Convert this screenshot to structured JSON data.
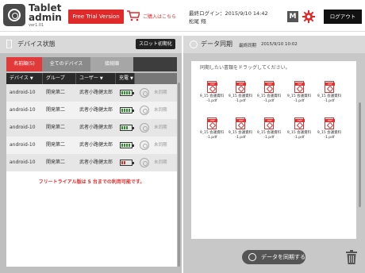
{
  "header": {
    "brand_title": "Tablet",
    "brand_subtitle": "admin",
    "version": "ver1.01",
    "trial_button": "Free Trial Version",
    "cart_label": "ご購入はこちら",
    "last_login": "最終ログイン：2015/9/10 14:42",
    "user_name": "松尾 翔",
    "m_button": "M",
    "logout_button": "ログアウト",
    "accent_color": "#e02a2a"
  },
  "left_panel": {
    "title": "デバイス状態",
    "reset_button": "スロット初期化",
    "tabs": [
      {
        "label": "名前順(5)"
      },
      {
        "label": "全てのデバイス"
      },
      {
        "label": "接続順"
      },
      {
        "label": ""
      }
    ],
    "columns": [
      {
        "label": "デバイス",
        "sort": "▼"
      },
      {
        "label": "グループ",
        "sort": ""
      },
      {
        "label": "ユーザー",
        "sort": "▼"
      },
      {
        "label": "充電",
        "sort": "▼"
      }
    ],
    "rows": [
      {
        "device": "android-10",
        "group": "開発第二",
        "user": "武者小路健太郎",
        "battery_level": 4,
        "battery_color": "#2e8b2e",
        "sync": "未同期"
      },
      {
        "device": "android-10",
        "group": "開発第二",
        "user": "武者小路健太郎",
        "battery_level": 4,
        "battery_color": "#2e8b2e",
        "sync": "未同期"
      },
      {
        "device": "android-10",
        "group": "開発第二",
        "user": "武者小路健太郎",
        "battery_level": 3,
        "battery_color": "#2e8b2e",
        "sync": "未同期"
      },
      {
        "device": "android-10",
        "group": "開発第二",
        "user": "武者小路健太郎",
        "battery_level": 4,
        "battery_color": "#2e8b2e",
        "sync": "未同期"
      },
      {
        "device": "android-10",
        "group": "開発第二",
        "user": "武者小路健太郎",
        "battery_level": 2,
        "battery_color": "#c0392b",
        "sync": "未同期"
      }
    ],
    "notice": "フリートライアル版は 5 台までの利用可能です。"
  },
  "right_panel": {
    "title": "データ同期",
    "last_sync_label": "最終同期",
    "last_sync_time": "2015/9/10 10:02",
    "drop_text": "同期したい書類をドラッグしてください。",
    "files": [
      {
        "line1": "9_15 会議資料",
        "line2": "-1.pdf"
      },
      {
        "line1": "9_15 会議資料",
        "line2": "-1.pdf"
      },
      {
        "line1": "9_15 会議資料",
        "line2": "-1.pdf"
      },
      {
        "line1": "9_15 会議資料",
        "line2": "-1.pdf"
      },
      {
        "line1": "9_15 会議資料",
        "line2": "-1.pdf"
      },
      {
        "line1": "9_15 会議資料",
        "line2": "-1.pdf"
      },
      {
        "line1": "9_15 会議資料",
        "line2": "-1.pdf"
      },
      {
        "line1": "9_15 会議資料",
        "line2": "-1.pdf"
      },
      {
        "line1": "9_15 会議資料",
        "line2": "-1.pdf"
      },
      {
        "line1": "9_15 会議資料",
        "line2": "-1.pdf"
      }
    ],
    "sync_button": "データを同期する"
  }
}
